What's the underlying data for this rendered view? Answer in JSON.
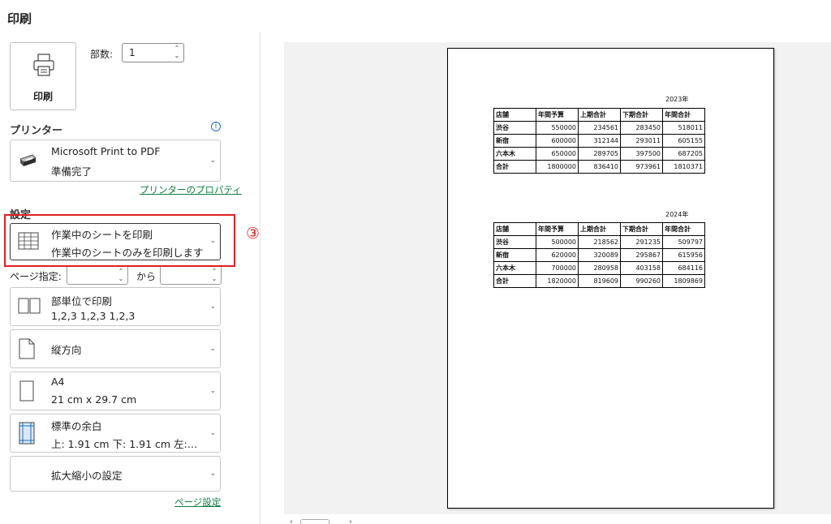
{
  "header": {
    "title": "印刷"
  },
  "print_button": {
    "label": "印刷"
  },
  "copies": {
    "label": "部数:",
    "value": "1"
  },
  "printer": {
    "heading": "プリンター",
    "name": "Microsoft Print to PDF",
    "status": "準備完了",
    "properties_link": "プリンターのプロパティ"
  },
  "settings": {
    "heading": "設定",
    "scope": {
      "title": "作業中のシートを印刷",
      "subtitle": "作業中のシートのみを印刷します"
    },
    "pages": {
      "label": "ページ指定:",
      "to_label": "から"
    },
    "collate": {
      "title": "部単位で印刷",
      "subtitle": "1,2,3    1,2,3    1,2,3"
    },
    "orientation": {
      "title": "縦方向"
    },
    "paper": {
      "title": "A4",
      "subtitle": "21 cm x 29.7 cm"
    },
    "margins": {
      "title": "標準の余白",
      "subtitle": "上: 1.91 cm 下: 1.91 cm 左:…"
    },
    "scaling": {
      "title": "拡大縮小の設定"
    },
    "page_setup_link": "ページ設定"
  },
  "annotation": {
    "step": "③"
  },
  "preview": {
    "tables": [
      {
        "year": "2023年",
        "header": [
          "店舗",
          "年間予算",
          "上期合計",
          "下期合計",
          "年間合計"
        ],
        "rows": [
          [
            "渋谷",
            "550000",
            "234561",
            "283450",
            "518011"
          ],
          [
            "新宿",
            "600000",
            "312144",
            "293011",
            "605155"
          ],
          [
            "六本木",
            "650000",
            "289705",
            "397500",
            "687205"
          ],
          [
            "合計",
            "1800000",
            "836410",
            "973961",
            "1810371"
          ]
        ]
      },
      {
        "year": "2024年",
        "header": [
          "店舗",
          "年間予算",
          "上期合計",
          "下期合計",
          "年間合計"
        ],
        "rows": [
          [
            "渋谷",
            "500000",
            "218562",
            "291235",
            "509797"
          ],
          [
            "新宿",
            "620000",
            "320089",
            "295867",
            "615956"
          ],
          [
            "六本木",
            "700000",
            "280958",
            "403158",
            "684116"
          ],
          [
            "合計",
            "1820000",
            "819609",
            "990260",
            "1809869"
          ]
        ]
      }
    ]
  },
  "colors": {
    "accent_link": "#107c41",
    "highlight": "#e02020",
    "info": "#1a6fc4"
  }
}
